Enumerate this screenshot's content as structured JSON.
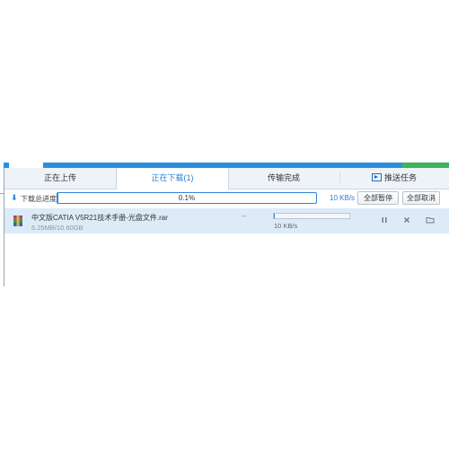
{
  "tabs": [
    {
      "label": "正在上传",
      "active": false
    },
    {
      "label": "正在下载(1)",
      "active": true
    },
    {
      "label": "传输完成",
      "active": false
    },
    {
      "label": "推送任务",
      "active": false,
      "icon": "push-task-icon"
    }
  ],
  "total": {
    "label": "下载总进度",
    "percent_text": "0.1%",
    "progress": 0.001,
    "speed": "10 KB/s",
    "pause_all": "全部暂停",
    "cancel_all": "全部取消"
  },
  "download": {
    "file_name": "中文版CATIA V5R21技术手册-光盘文件.rar",
    "size": "6.25MB/10.60GB",
    "time_left": "--",
    "speed": "10 KB/s",
    "progress": 0.001,
    "actions": [
      "pause-icon",
      "close-icon",
      "folder-icon"
    ]
  },
  "colors": {
    "accent": "#2b8fe0",
    "row_highlight": "#ddebf8",
    "tab_bar": "#eef3f8"
  }
}
